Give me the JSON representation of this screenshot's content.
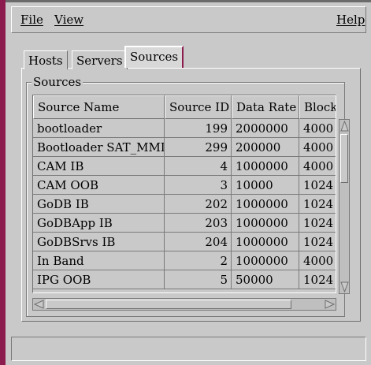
{
  "menubar": {
    "file": "File",
    "view": "View",
    "help": "Help"
  },
  "tabs": [
    {
      "label": "Hosts",
      "active": false
    },
    {
      "label": "Servers",
      "active": false
    },
    {
      "label": "Sources",
      "active": true
    }
  ],
  "group": {
    "title": "Sources"
  },
  "table": {
    "columns": [
      "Source Name",
      "Source ID",
      "Data Rate",
      "Block"
    ],
    "rows": [
      [
        "bootloader",
        "199",
        "2000000",
        "4000"
      ],
      [
        "Bootloader SAT_MMDs",
        "299",
        "200000",
        "4000"
      ],
      [
        "CAM IB",
        "4",
        "1000000",
        "4000"
      ],
      [
        "CAM OOB",
        "3",
        "10000",
        "1024"
      ],
      [
        "GoDB IB",
        "202",
        "1000000",
        "1024"
      ],
      [
        "GoDBApp IB",
        "203",
        "1000000",
        "1024"
      ],
      [
        "GoDBSrvs IB",
        "204",
        "1000000",
        "1024"
      ],
      [
        "In Band",
        "2",
        "1000000",
        "4000"
      ],
      [
        "IPG OOB",
        "5",
        "50000",
        "1024"
      ]
    ]
  },
  "status": {
    "text": ""
  },
  "colors": {
    "window_bg": "#c9c9c9",
    "accent": "#8b1c4d"
  }
}
